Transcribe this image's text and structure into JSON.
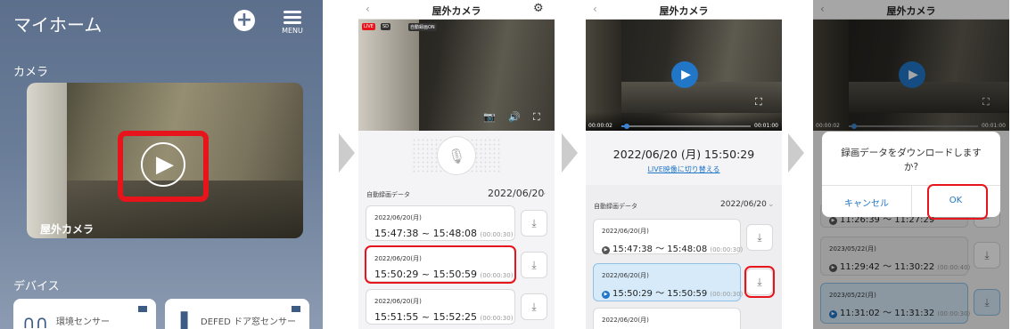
{
  "home": {
    "title": "マイホーム",
    "menu_label": "MENU",
    "camera_section": "カメラ",
    "camera_name": "屋外カメラ",
    "device_section": "デバイス",
    "devices": [
      {
        "name": "環境センサー"
      },
      {
        "name": "DEFED ドア窓センサー"
      }
    ]
  },
  "live": {
    "header": "屋外カメラ",
    "badges": {
      "live": "LIVE",
      "sd": "SD",
      "auto": "自動録画ON"
    },
    "section_label": "自動録画データ",
    "date": "2022/06/20",
    "rows": [
      {
        "date": "2022/06/20(月)",
        "range": "15:47:38 ~ 15:48:08",
        "dur": "(00:00:30)"
      },
      {
        "date": "2022/06/20(月)",
        "range": "15:50:29 ~ 15:50:59",
        "dur": "(00:00:30)"
      },
      {
        "date": "2022/06/20(月)",
        "range": "15:51:55 ~ 15:52:25",
        "dur": "(00:00:30)"
      }
    ]
  },
  "playback": {
    "header": "屋外カメラ",
    "time_start": "00:00:02",
    "time_end": "00:01:00",
    "datetime": "2022/06/20 (月)  15:50:29",
    "switch_link": "LIVE映像に切り替える",
    "section_label": "自動録画データ",
    "date": "2022/06/20",
    "rows": [
      {
        "date": "2022/06/20(月)",
        "range": "15:47:38 〜 15:48:08",
        "dur": "(00:00:30)"
      },
      {
        "date": "2022/06/20(月)",
        "range": "15:50:29 〜 15:50:59",
        "dur": "(00:00:30)"
      },
      {
        "date": "2022/06/20(月)",
        "range": "",
        "dur": ""
      }
    ]
  },
  "dialog": {
    "header": "屋外カメラ",
    "time_start": "00:00:02",
    "time_end": "00:01:00",
    "message": "録画データをダウンロードします か?",
    "cancel": "キャンセル",
    "ok": "OK",
    "rows": [
      {
        "date": "",
        "range": "11:26:39 〜 11:27:29",
        "dur": ""
      },
      {
        "date": "2023/05/22(月)",
        "range": "11:29:42 〜 11:30:22",
        "dur": "(00:00:40)"
      },
      {
        "date": "2023/05/22(月)",
        "range": "11:31:02 〜 11:31:32",
        "dur": "(00:00:30)"
      }
    ]
  },
  "colors": {
    "accent": "#2176c8",
    "highlight_red": "#e8141b",
    "header_bg": "#5c6f8c"
  }
}
